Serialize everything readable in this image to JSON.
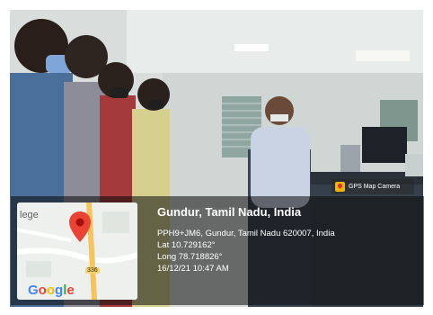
{
  "photo": {
    "badge_text": "GPS Map Camera"
  },
  "map": {
    "place_label": "lege",
    "road_number": "336",
    "logo_letters": [
      "G",
      "o",
      "o",
      "g",
      "l",
      "e"
    ]
  },
  "location": {
    "title": "Gundur, Tamil Nadu, India",
    "address": "PPH9+JM6, Gundur, Tamil Nadu 620007, India",
    "lat": "Lat 10.729162°",
    "long": "Long 78.718826°",
    "datetime": "16/12/21 10:47 AM"
  }
}
